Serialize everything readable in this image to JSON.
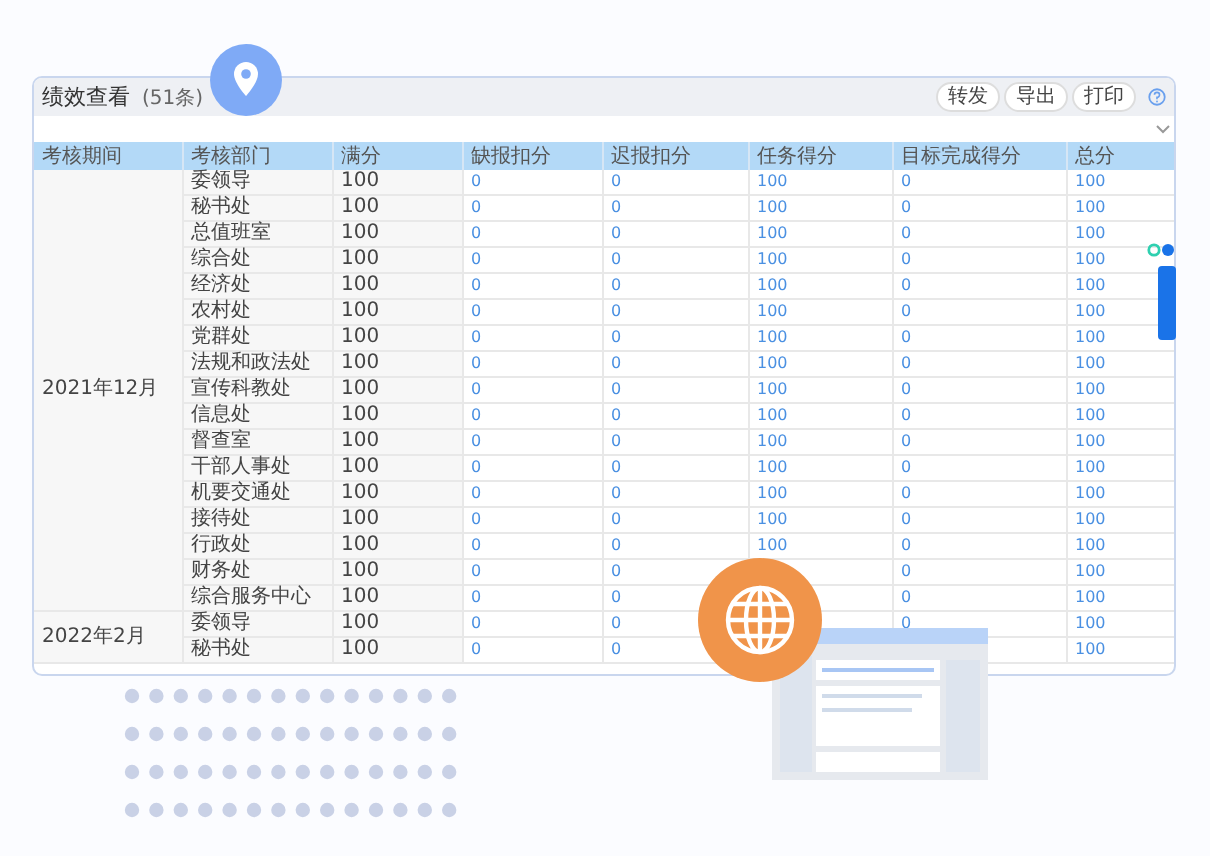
{
  "panel": {
    "title": "绩效查看",
    "count": "(51条)",
    "buttons": [
      "转发",
      "导出",
      "打印"
    ]
  },
  "table": {
    "columns": [
      "考核期间",
      "考核部门",
      "满分",
      "缺报扣分",
      "迟报扣分",
      "任务得分",
      "目标完成得分",
      "总分"
    ],
    "groups": [
      {
        "period": "2021年12月",
        "rows": [
          {
            "cells": [
              "委领导",
              "100",
              "0",
              "0",
              "100",
              "0",
              "100"
            ]
          },
          {
            "cells": [
              "秘书处",
              "100",
              "0",
              "0",
              "100",
              "0",
              "100"
            ]
          },
          {
            "cells": [
              "总值班室",
              "100",
              "0",
              "0",
              "100",
              "0",
              "100"
            ]
          },
          {
            "cells": [
              "综合处",
              "100",
              "0",
              "0",
              "100",
              "0",
              "100"
            ]
          },
          {
            "cells": [
              "经济处",
              "100",
              "0",
              "0",
              "100",
              "0",
              "100"
            ]
          },
          {
            "cells": [
              "农村处",
              "100",
              "0",
              "0",
              "100",
              "0",
              "100"
            ]
          },
          {
            "cells": [
              "党群处",
              "100",
              "0",
              "0",
              "100",
              "0",
              "100"
            ]
          },
          {
            "cells": [
              "法规和政法处",
              "100",
              "0",
              "0",
              "100",
              "0",
              "100"
            ]
          },
          {
            "cells": [
              "宣传科教处",
              "100",
              "0",
              "0",
              "100",
              "0",
              "100"
            ]
          },
          {
            "cells": [
              "信息处",
              "100",
              "0",
              "0",
              "100",
              "0",
              "100"
            ]
          },
          {
            "cells": [
              "督查室",
              "100",
              "0",
              "0",
              "100",
              "0",
              "100"
            ]
          },
          {
            "cells": [
              "干部人事处",
              "100",
              "0",
              "0",
              "100",
              "0",
              "100"
            ]
          },
          {
            "cells": [
              "机要交通处",
              "100",
              "0",
              "0",
              "100",
              "0",
              "100"
            ]
          },
          {
            "cells": [
              "接待处",
              "100",
              "0",
              "0",
              "100",
              "0",
              "100"
            ]
          },
          {
            "cells": [
              "行政处",
              "100",
              "0",
              "0",
              "100",
              "0",
              "100"
            ]
          },
          {
            "cells": [
              "财务处",
              "100",
              "0",
              "0",
              null,
              "0",
              "100"
            ]
          },
          {
            "cells": [
              "综合服务中心",
              "100",
              "0",
              "0",
              null,
              "0",
              "100"
            ]
          }
        ]
      },
      {
        "period": "2022年2月",
        "rows": [
          {
            "cells": [
              "委领导",
              "100",
              "0",
              "0",
              null,
              "0",
              "100"
            ]
          },
          {
            "cells": [
              "秘书处",
              "100",
              "0",
              "0",
              null,
              null,
              "100"
            ]
          }
        ]
      }
    ]
  }
}
